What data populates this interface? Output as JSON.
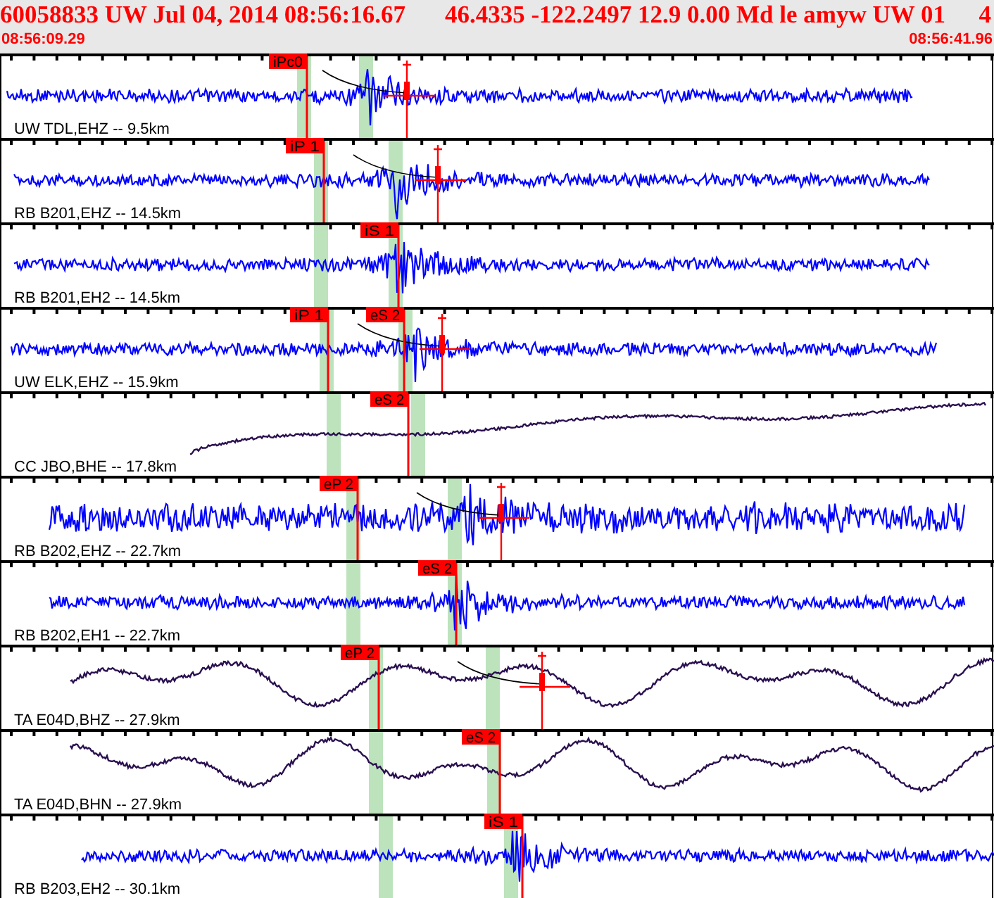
{
  "header": {
    "event": "60058833 UW Jul 04, 2014 08:56:16.67",
    "solution": "46.4335 -122.2497 12.9 0.00 Md le amyw UW 01",
    "count": "4",
    "start_time": "08:56:09.29",
    "end_time": "08:56:41.96"
  },
  "traces": [
    {
      "label": "UW TDL,EHZ -- 9.5km",
      "kind": "short-period",
      "picks": [
        {
          "label": "iPc0"
        }
      ]
    },
    {
      "label": "RB B201,EHZ -- 14.5km",
      "kind": "short-period",
      "picks": [
        {
          "label": "iP 1"
        }
      ]
    },
    {
      "label": "RB B201,EH2 -- 14.5km",
      "kind": "short-period",
      "picks": [
        {
          "label": "iS 1"
        }
      ]
    },
    {
      "label": "UW ELK,EHZ -- 15.9km",
      "kind": "short-period",
      "picks": [
        {
          "label": "iP 1"
        },
        {
          "label": "eS 2"
        }
      ]
    },
    {
      "label": "CC JBO,BHE -- 17.8km",
      "kind": "broadband",
      "picks": [
        {
          "label": "eS 2"
        }
      ]
    },
    {
      "label": "RB B202,EHZ -- 22.7km",
      "kind": "short-period",
      "picks": [
        {
          "label": "eP 2"
        }
      ]
    },
    {
      "label": "RB B202,EH1 -- 22.7km",
      "kind": "short-period",
      "picks": [
        {
          "label": "eS 2"
        }
      ]
    },
    {
      "label": "TA E04D,BHZ -- 27.9km",
      "kind": "broadband",
      "picks": [
        {
          "label": "eP 2"
        }
      ]
    },
    {
      "label": "TA E04D,BHN -- 27.9km",
      "kind": "broadband",
      "picks": [
        {
          "label": "eS 2"
        }
      ]
    },
    {
      "label": "RB B203,EH2 -- 30.1km",
      "kind": "short-period",
      "picks": [
        {
          "label": "iS 1"
        }
      ]
    }
  ]
}
